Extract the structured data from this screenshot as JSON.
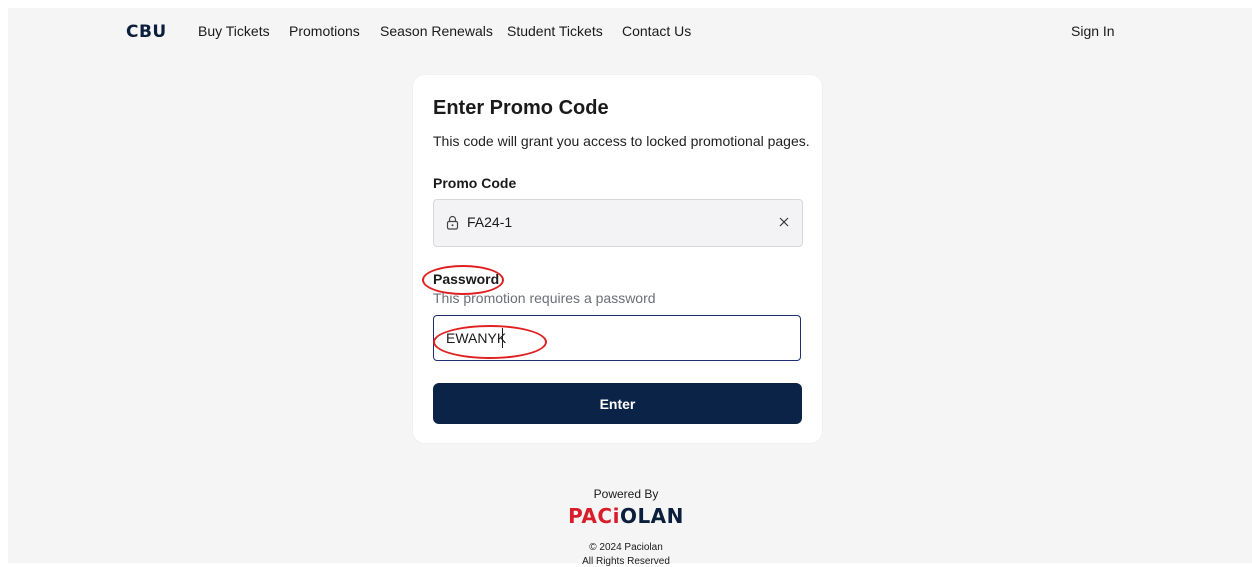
{
  "nav": {
    "logo": "CBU",
    "links": [
      "Buy Tickets",
      "Promotions",
      "Season Renewals",
      "Student Tickets",
      "Contact Us"
    ],
    "sign_in": "Sign In"
  },
  "card": {
    "title": "Enter Promo Code",
    "subtitle": "This code will grant you access to locked promotional pages.",
    "promo": {
      "label": "Promo Code",
      "value": "FA24-1",
      "lock_icon": "lock-icon",
      "clear_icon": "close-icon"
    },
    "password": {
      "label": "Password",
      "hint": "This promotion requires a password",
      "value": "EWANYK"
    },
    "enter_button": "Enter"
  },
  "footer": {
    "powered_by": "Powered By",
    "brand_red": "PACi",
    "brand_dark": "OLAN",
    "copyright": "© 2024 Paciolan",
    "rights": "All Rights Reserved"
  },
  "colors": {
    "brand_navy": "#0b2346",
    "annotation_red": "#e02020",
    "paciolan_red": "#d81e2b"
  }
}
